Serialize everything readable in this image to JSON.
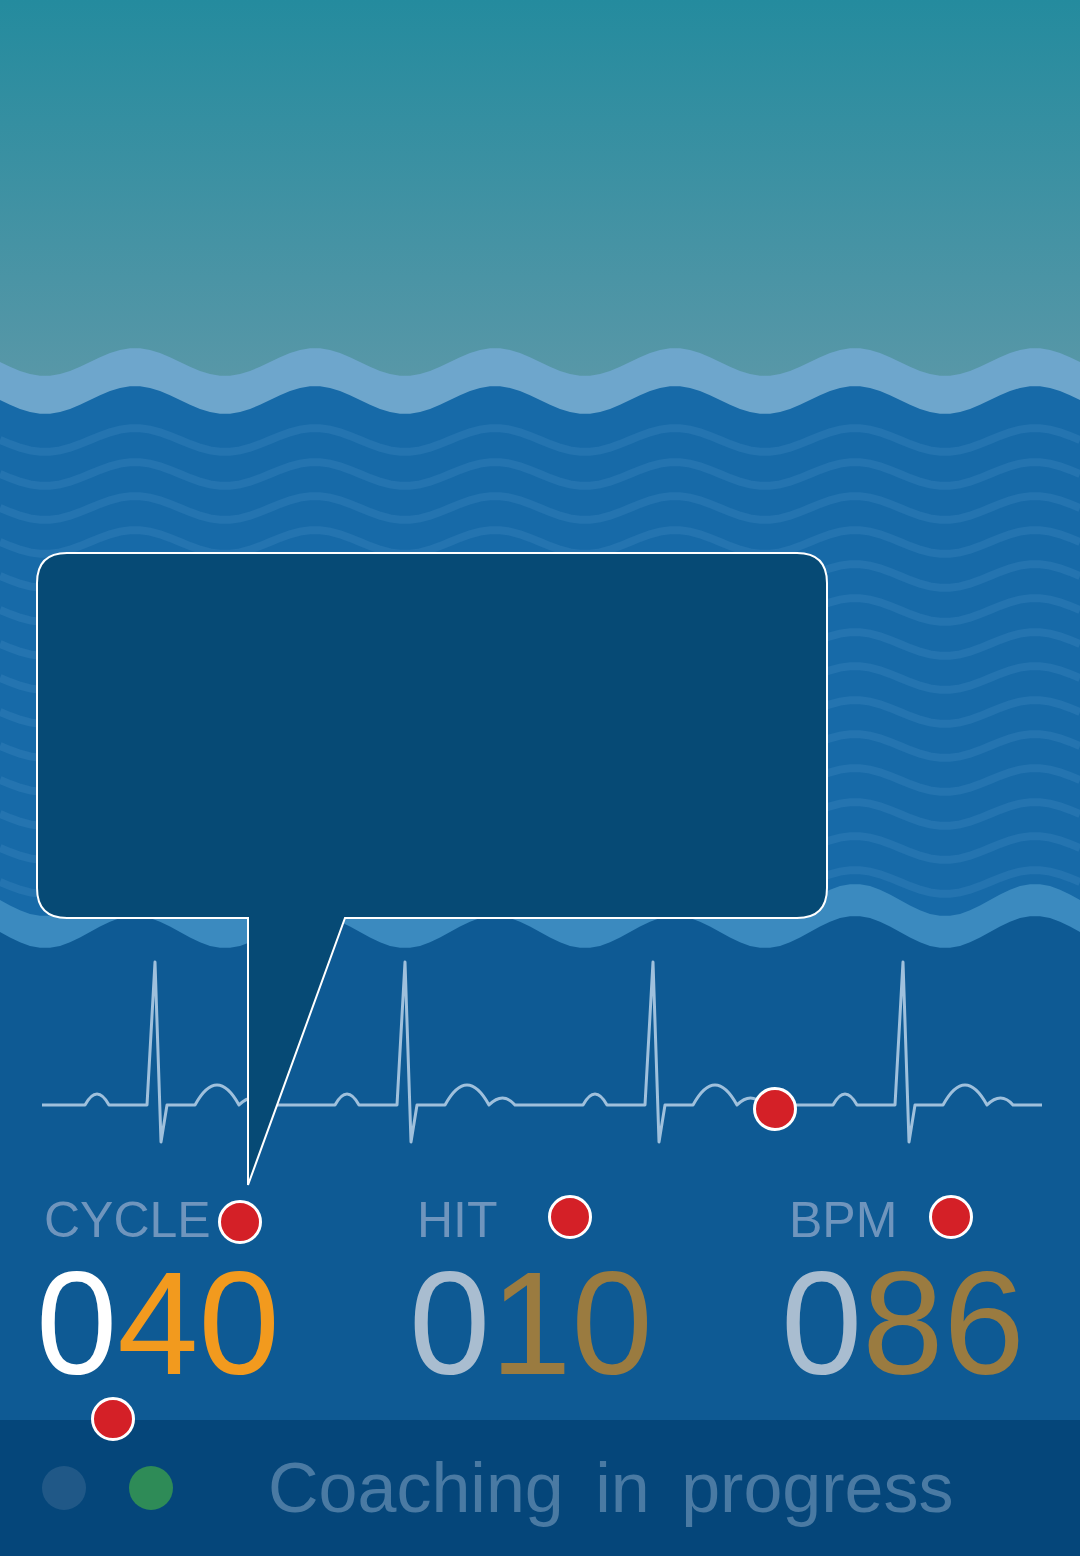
{
  "stats": [
    {
      "label": "CYCLE",
      "lead": "0",
      "value": "40",
      "selected": true
    },
    {
      "label": "HIT",
      "lead": "0",
      "value": "10",
      "selected": false
    },
    {
      "label": "BPM",
      "lead": "0",
      "value": "86",
      "selected": false
    }
  ],
  "status_bar": {
    "lights": [
      {
        "on": false,
        "color": "#2a5f8c"
      },
      {
        "on": true,
        "color": "#2e8b57"
      }
    ],
    "text": "Coaching in progress"
  }
}
